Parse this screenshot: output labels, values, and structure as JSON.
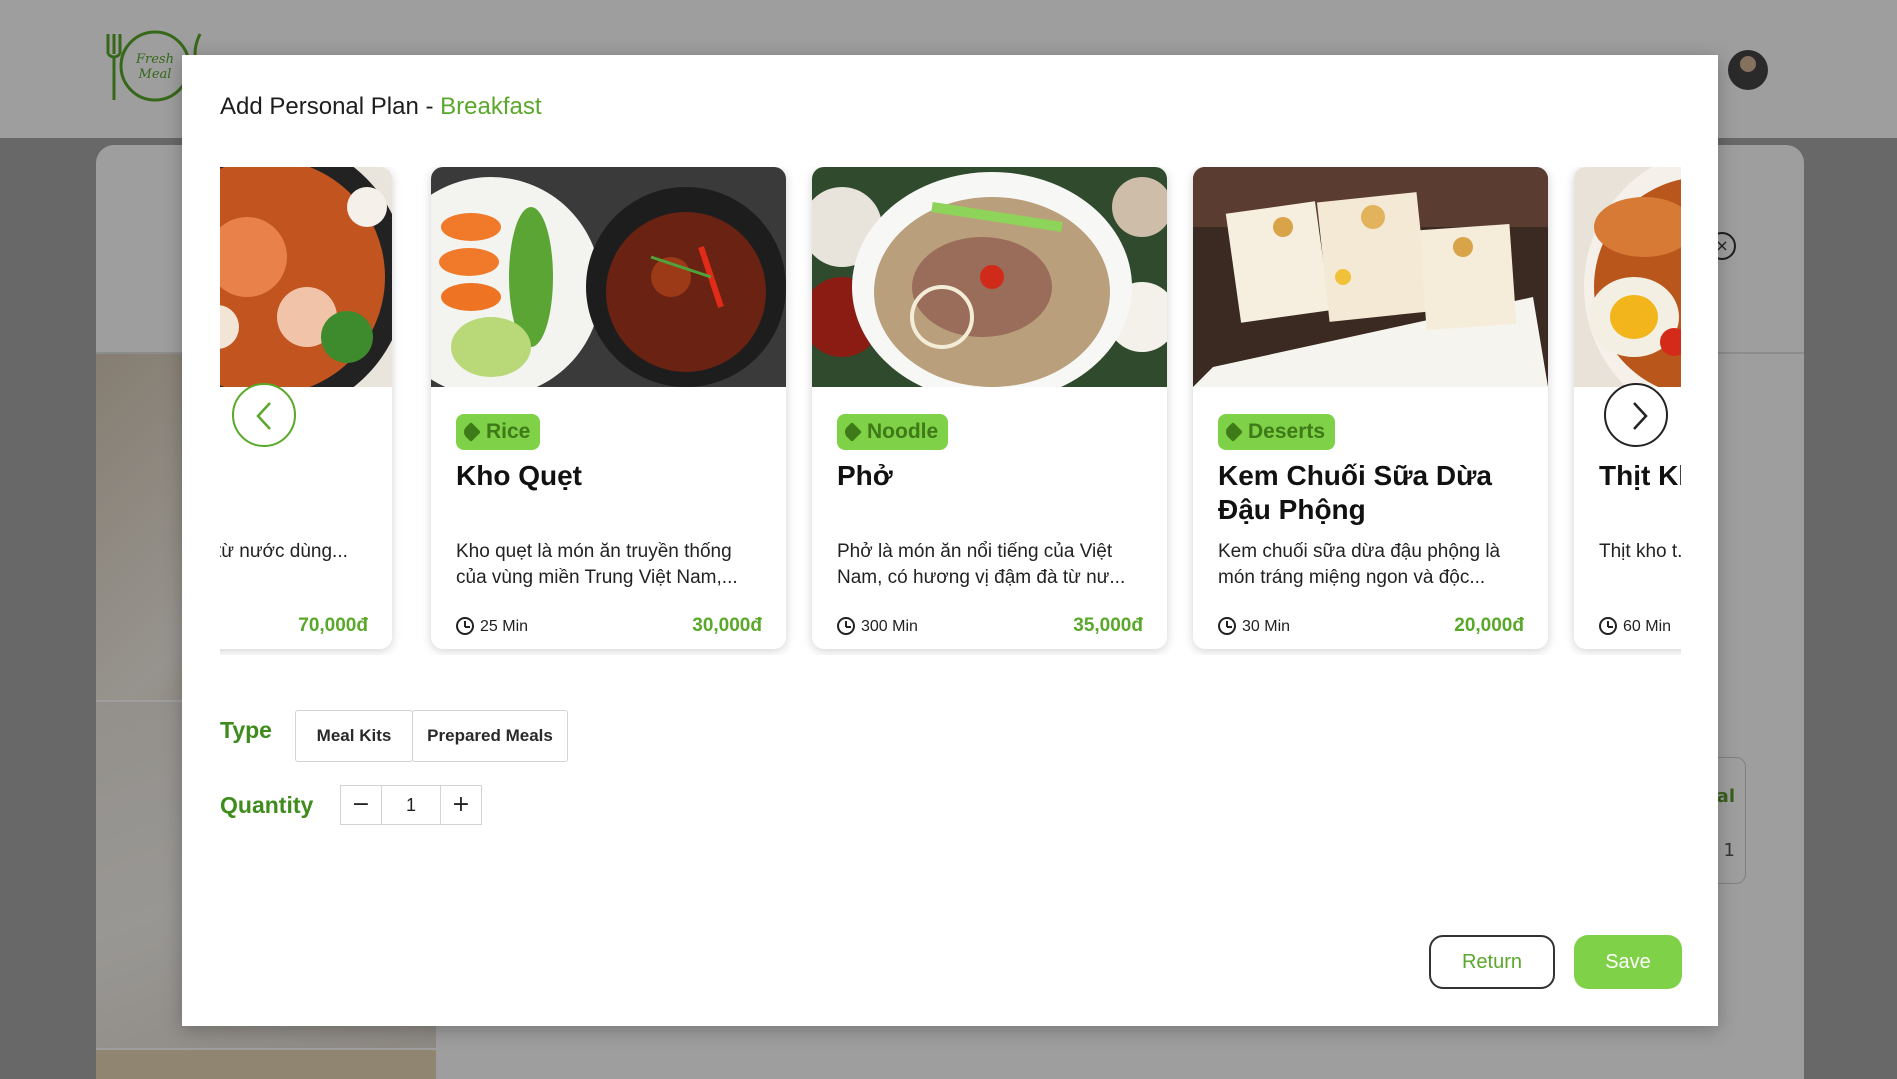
{
  "modal": {
    "title_prefix": "Add Personal Plan - ",
    "title_meal": "Breakfast"
  },
  "dishes": [
    {
      "tag": "",
      "title": "",
      "desc": "ăn nổi tiếng với vị  từ nước dùng...",
      "time": "",
      "price": "70,000đ"
    },
    {
      "tag": "Rice",
      "title": "Kho Quẹt",
      "desc": "Kho quẹt là món ăn truyền thống của vùng miền Trung Việt Nam,...",
      "time": "25 Min",
      "price": "30,000đ"
    },
    {
      "tag": "Noodle",
      "title": "Phở",
      "desc": "Phở là món ăn nổi tiếng của Việt Nam, có hương vị đậm đà từ nư...",
      "time": "300 Min",
      "price": "35,000đ"
    },
    {
      "tag": "Deserts",
      "title": "Kem Chuối Sữa Dừa Đậu Phộng",
      "desc": "Kem chuối sữa dừa đậu phộng là món tráng miệng ngon và độc...",
      "time": "30 Min",
      "price": "20,000đ"
    },
    {
      "tag": "",
      "title": "Thịt Kho Trứng",
      "desc": "Thịt kho t... thống khó...",
      "time": "60 Min",
      "price": ""
    }
  ],
  "form": {
    "type_label": "Type",
    "type_options": [
      "Meal Kits",
      "Prepared Meals"
    ],
    "quantity_label": "Quantity",
    "quantity_value": "1",
    "minus": "−",
    "plus": "+"
  },
  "actions": {
    "return_label": "Return",
    "save_label": "Save"
  },
  "background": {
    "logo_text": "Fresh Meal",
    "side_card_text_1": "al",
    "side_card_text_2": "1",
    "close_glyph": "×"
  },
  "colors": {
    "accent_green": "#5aa82a",
    "tag_green": "#7fd148",
    "label_green": "#3f8b1c"
  }
}
